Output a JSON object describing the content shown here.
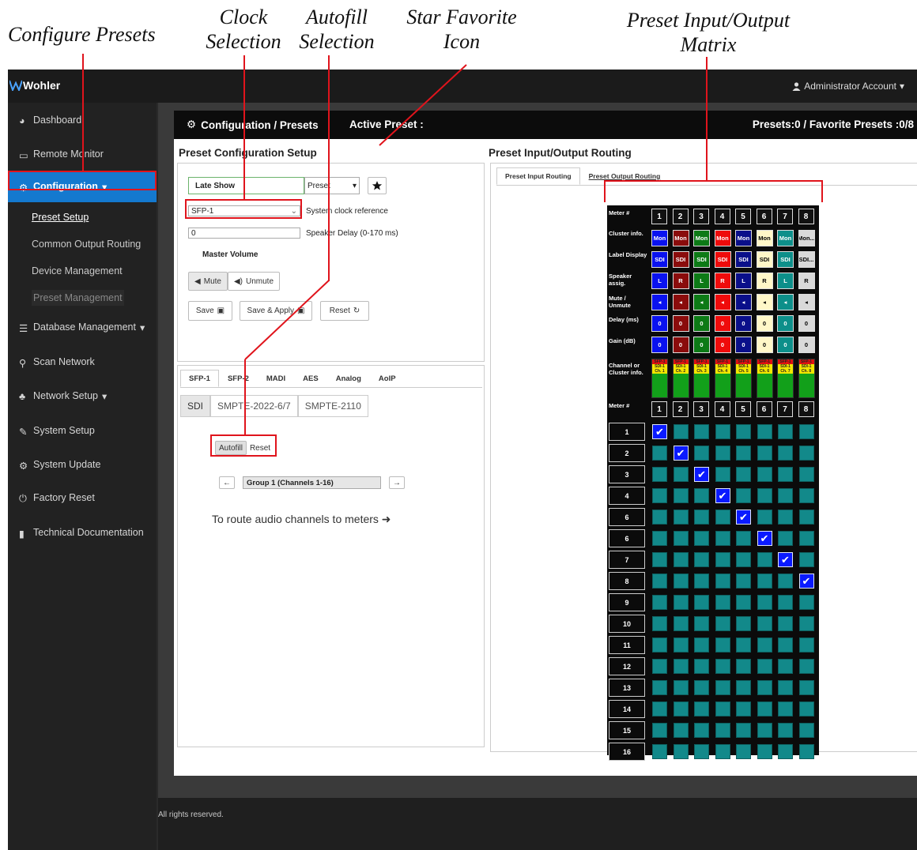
{
  "callouts": {
    "configure_presets": "Configure Presets",
    "clock_line1": "Clock",
    "clock_line2": "Selection",
    "autofill_line1": "Autofill",
    "autofill_line2": "Selection",
    "star_line1": "Star Favorite",
    "star_line2": "Icon",
    "matrix_line1": "Preset Input/Output",
    "matrix_line2": "Matrix"
  },
  "topbar": {
    "brand": "Wohler",
    "account": "Administrator Account"
  },
  "sidebar": {
    "items": [
      "Dashboard",
      "Remote Monitor",
      "Configuration",
      "Database Management",
      "Scan Network",
      "Network Setup",
      "System Setup",
      "System Update",
      "Factory Reset",
      "Technical Documentation"
    ],
    "sub_items": [
      "Preset Setup",
      "Common Output Routing",
      "Device Management",
      "Preset Management"
    ]
  },
  "header": {
    "title": "Configuration / Presets",
    "active_preset": "Active Preset :",
    "counts": "Presets:0 / Favorite Presets :0/8"
  },
  "setup": {
    "title": "Preset Configuration Setup",
    "preset_name": "Late Show",
    "preset_select": "Preset",
    "clock_value": "SFP-1",
    "clock_label": "System clock reference",
    "delay_value": "0",
    "delay_label": "Speaker Delay (0-170 ms)",
    "master_volume": "Master Volume",
    "mute": "Mute",
    "unmute": "Unmute",
    "save": "Save",
    "save_apply": "Save & Apply",
    "reset": "Reset"
  },
  "input_tabs": [
    "SFP-1",
    "SFP-2",
    "MADI",
    "AES",
    "Analog",
    "AoIP"
  ],
  "sdi_tabs": [
    "SDI",
    "SMPTE-2022-6/7",
    "SMPTE-2110"
  ],
  "autofill": {
    "autofill": "Autofill",
    "reset": "Reset"
  },
  "group_label": "Group 1 (Channels 1-16)",
  "route_hint": "To route audio channels to meters",
  "routing": {
    "title": "Preset Input/Output Routing",
    "tab_input": "Preset Input Routing",
    "tab_output": "Preset Output Routing"
  },
  "matrix": {
    "row_labels": [
      "Meter #",
      "Cluster info.",
      "Label Display",
      "Speaker assig.",
      "Mute / Unmute",
      "Delay (ms)",
      "Gain (dB)",
      "Channel or Cluster info.",
      "Meter #"
    ],
    "meters": [
      "1",
      "2",
      "3",
      "4",
      "5",
      "6",
      "7",
      "8"
    ],
    "meter_colors": [
      "#0a12f0",
      "#8a0c0c",
      "#0d7a16",
      "#ef0b0b",
      "#0a0f8a",
      "#fff7c8",
      "#0d8f8a",
      "#d9d9d9"
    ],
    "cluster": [
      "Mon",
      "Mon",
      "Mon",
      "Mon",
      "Mon",
      "Mon",
      "Mon",
      "Mon..."
    ],
    "label_display": [
      "SDI",
      "SDI",
      "SDI",
      "SDI",
      "SDI",
      "SDI",
      "SDI",
      "SDI..."
    ],
    "speaker": [
      "L",
      "R",
      "L",
      "R",
      "L",
      "R",
      "L",
      "R"
    ],
    "delay": [
      "0",
      "0",
      "0",
      "0",
      "0",
      "0",
      "0",
      "0"
    ],
    "gain": [
      "0",
      "0",
      "0",
      "0",
      "0",
      "0",
      "0",
      "0"
    ],
    "channel_info": [
      "SFP-1 SDI-1 Ch. 1",
      "SFP-1 SDI-1 Ch. 2",
      "SFP-1 SDI-1 Ch. 3",
      "SFP-1 SDI-1 Ch. 4",
      "SFP-1 SDI-1 Ch. 5",
      "SFP-1 SDI-1 Ch. 6",
      "SFP-1 SDI-1 Ch. 7",
      "SFP-1 SDI-1 Ch. 8"
    ],
    "channel_rows": [
      "1",
      "2",
      "3",
      "4",
      "6",
      "6",
      "7",
      "8",
      "9",
      "10",
      "11",
      "12",
      "13",
      "14",
      "15",
      "16"
    ],
    "checked": [
      [
        0,
        0
      ],
      [
        1,
        1
      ],
      [
        2,
        2
      ],
      [
        3,
        3
      ],
      [
        4,
        4
      ],
      [
        5,
        5
      ],
      [
        6,
        6
      ],
      [
        7,
        7
      ]
    ]
  },
  "footer": "All rights reserved."
}
